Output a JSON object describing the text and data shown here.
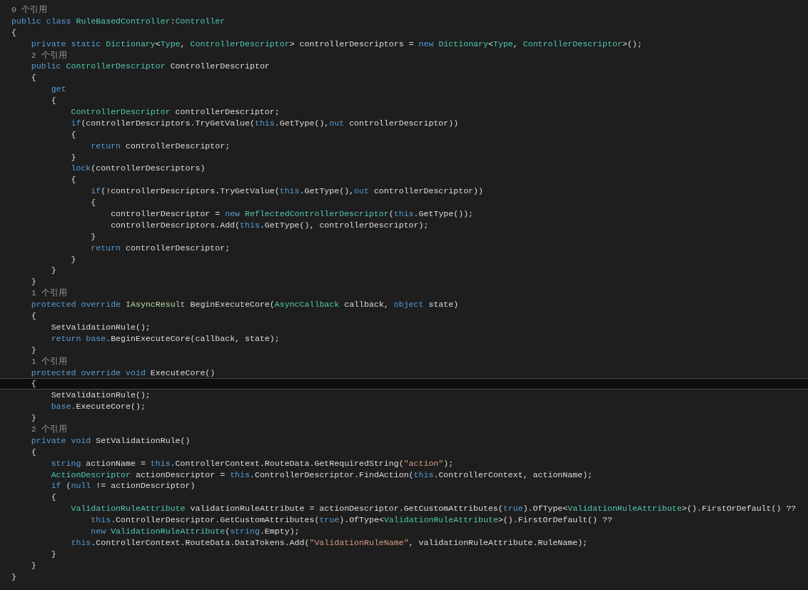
{
  "editor": {
    "lines": [
      {
        "kind": "codelens",
        "current": false,
        "tokens": [
          {
            "kind": "plain",
            "text": "0 个引用"
          }
        ]
      },
      {
        "kind": "code",
        "current": false,
        "tokens": [
          {
            "kind": "keyword",
            "text": "public class "
          },
          {
            "kind": "type",
            "text": "RuleBasedController"
          },
          {
            "kind": "plain",
            "text": ":"
          },
          {
            "kind": "type",
            "text": "Controller"
          }
        ]
      },
      {
        "kind": "code",
        "current": false,
        "tokens": [
          {
            "kind": "plain",
            "text": "{"
          }
        ]
      },
      {
        "kind": "code",
        "current": false,
        "tokens": [
          {
            "kind": "keyword",
            "text": "    private static "
          },
          {
            "kind": "type",
            "text": "Dictionary"
          },
          {
            "kind": "plain",
            "text": "<"
          },
          {
            "kind": "type",
            "text": "Type"
          },
          {
            "kind": "plain",
            "text": ", "
          },
          {
            "kind": "type",
            "text": "ControllerDescriptor"
          },
          {
            "kind": "plain",
            "text": "> controllerDescriptors = "
          },
          {
            "kind": "keyword",
            "text": "new "
          },
          {
            "kind": "type",
            "text": "Dictionary"
          },
          {
            "kind": "plain",
            "text": "<"
          },
          {
            "kind": "type",
            "text": "Type"
          },
          {
            "kind": "plain",
            "text": ", "
          },
          {
            "kind": "type",
            "text": "ControllerDescriptor"
          },
          {
            "kind": "plain",
            "text": ">();"
          }
        ]
      },
      {
        "kind": "codelens",
        "current": false,
        "tokens": [
          {
            "kind": "plain",
            "text": "    2 个引用"
          }
        ]
      },
      {
        "kind": "code",
        "current": false,
        "tokens": [
          {
            "kind": "keyword",
            "text": "    public "
          },
          {
            "kind": "type",
            "text": "ControllerDescriptor"
          },
          {
            "kind": "plain",
            "text": " ControllerDescriptor"
          }
        ]
      },
      {
        "kind": "code",
        "current": false,
        "tokens": [
          {
            "kind": "plain",
            "text": "    {"
          }
        ]
      },
      {
        "kind": "code",
        "current": false,
        "tokens": [
          {
            "kind": "keyword",
            "text": "        get"
          }
        ]
      },
      {
        "kind": "code",
        "current": false,
        "tokens": [
          {
            "kind": "plain",
            "text": "        {"
          }
        ]
      },
      {
        "kind": "code",
        "current": false,
        "tokens": [
          {
            "kind": "type",
            "text": "            ControllerDescriptor"
          },
          {
            "kind": "plain",
            "text": " controllerDescriptor;"
          }
        ]
      },
      {
        "kind": "code",
        "current": false,
        "tokens": [
          {
            "kind": "keyword",
            "text": "            if"
          },
          {
            "kind": "plain",
            "text": "(controllerDescriptors.TryGetValue("
          },
          {
            "kind": "keyword",
            "text": "this"
          },
          {
            "kind": "plain",
            "text": ".GetType(),"
          },
          {
            "kind": "keyword",
            "text": "out"
          },
          {
            "kind": "plain",
            "text": " controllerDescriptor))"
          }
        ]
      },
      {
        "kind": "code",
        "current": false,
        "tokens": [
          {
            "kind": "plain",
            "text": "            {"
          }
        ]
      },
      {
        "kind": "code",
        "current": false,
        "tokens": [
          {
            "kind": "keyword",
            "text": "                return"
          },
          {
            "kind": "plain",
            "text": " controllerDescriptor;"
          }
        ]
      },
      {
        "kind": "code",
        "current": false,
        "tokens": [
          {
            "kind": "plain",
            "text": "            }"
          }
        ]
      },
      {
        "kind": "code",
        "current": false,
        "tokens": [
          {
            "kind": "keyword",
            "text": "            lock"
          },
          {
            "kind": "plain",
            "text": "(controllerDescriptors)"
          }
        ]
      },
      {
        "kind": "code",
        "current": false,
        "tokens": [
          {
            "kind": "plain",
            "text": "            {"
          }
        ]
      },
      {
        "kind": "code",
        "current": false,
        "tokens": [
          {
            "kind": "keyword",
            "text": "                if"
          },
          {
            "kind": "plain",
            "text": "(!controllerDescriptors.TryGetValue("
          },
          {
            "kind": "keyword",
            "text": "this"
          },
          {
            "kind": "plain",
            "text": ".GetType(),"
          },
          {
            "kind": "keyword",
            "text": "out"
          },
          {
            "kind": "plain",
            "text": " controllerDescriptor))"
          }
        ]
      },
      {
        "kind": "code",
        "current": false,
        "tokens": [
          {
            "kind": "plain",
            "text": "                {"
          }
        ]
      },
      {
        "kind": "code",
        "current": false,
        "tokens": [
          {
            "kind": "plain",
            "text": "                    controllerDescriptor = "
          },
          {
            "kind": "keyword",
            "text": "new "
          },
          {
            "kind": "type",
            "text": "ReflectedControllerDescriptor"
          },
          {
            "kind": "plain",
            "text": "("
          },
          {
            "kind": "keyword",
            "text": "this"
          },
          {
            "kind": "plain",
            "text": ".GetType());"
          }
        ]
      },
      {
        "kind": "code",
        "current": false,
        "tokens": [
          {
            "kind": "plain",
            "text": "                    controllerDescriptors.Add("
          },
          {
            "kind": "keyword",
            "text": "this"
          },
          {
            "kind": "plain",
            "text": ".GetType(), controllerDescriptor);"
          }
        ]
      },
      {
        "kind": "code",
        "current": false,
        "tokens": [
          {
            "kind": "plain",
            "text": "                }"
          }
        ]
      },
      {
        "kind": "code",
        "current": false,
        "tokens": [
          {
            "kind": "keyword",
            "text": "                return"
          },
          {
            "kind": "plain",
            "text": " controllerDescriptor;"
          }
        ]
      },
      {
        "kind": "code",
        "current": false,
        "tokens": [
          {
            "kind": "plain",
            "text": "            }"
          }
        ]
      },
      {
        "kind": "code",
        "current": false,
        "tokens": [
          {
            "kind": "plain",
            "text": "        }"
          }
        ]
      },
      {
        "kind": "code",
        "current": false,
        "tokens": [
          {
            "kind": "plain",
            "text": "    }"
          }
        ]
      },
      {
        "kind": "codelens",
        "current": false,
        "tokens": [
          {
            "kind": "plain",
            "text": "    1 个引用"
          }
        ]
      },
      {
        "kind": "code",
        "current": false,
        "tokens": [
          {
            "kind": "keyword",
            "text": "    protected override "
          },
          {
            "kind": "interface",
            "text": "IAsyncResult"
          },
          {
            "kind": "plain",
            "text": " BeginExecuteCore("
          },
          {
            "kind": "type",
            "text": "AsyncCallback"
          },
          {
            "kind": "plain",
            "text": " callback, "
          },
          {
            "kind": "keyword",
            "text": "object"
          },
          {
            "kind": "plain",
            "text": " state)"
          }
        ]
      },
      {
        "kind": "code",
        "current": false,
        "tokens": [
          {
            "kind": "plain",
            "text": "    {"
          }
        ]
      },
      {
        "kind": "code",
        "current": false,
        "tokens": [
          {
            "kind": "plain",
            "text": "        SetValidationRule();"
          }
        ]
      },
      {
        "kind": "code",
        "current": false,
        "tokens": [
          {
            "kind": "keyword",
            "text": "        return base"
          },
          {
            "kind": "plain",
            "text": ".BeginExecuteCore(callback, state);"
          }
        ]
      },
      {
        "kind": "code",
        "current": false,
        "tokens": [
          {
            "kind": "plain",
            "text": "    }"
          }
        ]
      },
      {
        "kind": "codelens",
        "current": false,
        "tokens": [
          {
            "kind": "plain",
            "text": "    1 个引用"
          }
        ]
      },
      {
        "kind": "code",
        "current": false,
        "tokens": [
          {
            "kind": "keyword",
            "text": "    protected override void"
          },
          {
            "kind": "plain",
            "text": " ExecuteCore()"
          }
        ]
      },
      {
        "kind": "code",
        "current": true,
        "tokens": [
          {
            "kind": "plain",
            "text": "    {"
          }
        ]
      },
      {
        "kind": "code",
        "current": false,
        "tokens": [
          {
            "kind": "plain",
            "text": "        SetValidationRule();"
          }
        ]
      },
      {
        "kind": "code",
        "current": false,
        "tokens": [
          {
            "kind": "keyword",
            "text": "        base"
          },
          {
            "kind": "plain",
            "text": ".ExecuteCore();"
          }
        ]
      },
      {
        "kind": "code",
        "current": false,
        "tokens": [
          {
            "kind": "plain",
            "text": "    }"
          }
        ]
      },
      {
        "kind": "codelens",
        "current": false,
        "tokens": [
          {
            "kind": "plain",
            "text": "    2 个引用"
          }
        ]
      },
      {
        "kind": "code",
        "current": false,
        "tokens": [
          {
            "kind": "keyword",
            "text": "    private void"
          },
          {
            "kind": "plain",
            "text": " SetValidationRule()"
          }
        ]
      },
      {
        "kind": "code",
        "current": false,
        "tokens": [
          {
            "kind": "plain",
            "text": "    {"
          }
        ]
      },
      {
        "kind": "code",
        "current": false,
        "tokens": [
          {
            "kind": "keyword",
            "text": "        string"
          },
          {
            "kind": "plain",
            "text": " actionName = "
          },
          {
            "kind": "keyword",
            "text": "this"
          },
          {
            "kind": "plain",
            "text": ".ControllerContext.RouteData.GetRequiredString("
          },
          {
            "kind": "string",
            "text": "\"action\""
          },
          {
            "kind": "plain",
            "text": ");"
          }
        ]
      },
      {
        "kind": "code",
        "current": false,
        "tokens": [
          {
            "kind": "type",
            "text": "        ActionDescriptor"
          },
          {
            "kind": "plain",
            "text": " actionDescriptor = "
          },
          {
            "kind": "keyword",
            "text": "this"
          },
          {
            "kind": "plain",
            "text": ".ControllerDescriptor.FindAction("
          },
          {
            "kind": "keyword",
            "text": "this"
          },
          {
            "kind": "plain",
            "text": ".ControllerContext, actionName);"
          }
        ]
      },
      {
        "kind": "code",
        "current": false,
        "tokens": [
          {
            "kind": "keyword",
            "text": "        if"
          },
          {
            "kind": "plain",
            "text": " ("
          },
          {
            "kind": "keyword",
            "text": "null"
          },
          {
            "kind": "plain",
            "text": " != actionDescriptor)"
          }
        ]
      },
      {
        "kind": "code",
        "current": false,
        "tokens": [
          {
            "kind": "plain",
            "text": "        {"
          }
        ]
      },
      {
        "kind": "code",
        "current": false,
        "tokens": [
          {
            "kind": "type",
            "text": "            ValidationRuleAttribute"
          },
          {
            "kind": "plain",
            "text": " validationRuleAttribute = actionDescriptor.GetCustomAttributes("
          },
          {
            "kind": "keyword",
            "text": "true"
          },
          {
            "kind": "plain",
            "text": ").OfType<"
          },
          {
            "kind": "type",
            "text": "ValidationRuleAttribute"
          },
          {
            "kind": "plain",
            "text": ">().FirstOrDefault() ??"
          }
        ]
      },
      {
        "kind": "code",
        "current": false,
        "tokens": [
          {
            "kind": "keyword",
            "text": "                this"
          },
          {
            "kind": "plain",
            "text": ".ControllerDescriptor.GetCustomAttributes("
          },
          {
            "kind": "keyword",
            "text": "true"
          },
          {
            "kind": "plain",
            "text": ").OfType<"
          },
          {
            "kind": "type",
            "text": "ValidationRuleAttribute"
          },
          {
            "kind": "plain",
            "text": ">().FirstOrDefault() ??"
          }
        ]
      },
      {
        "kind": "code",
        "current": false,
        "tokens": [
          {
            "kind": "keyword",
            "text": "                new "
          },
          {
            "kind": "type",
            "text": "ValidationRuleAttribute"
          },
          {
            "kind": "plain",
            "text": "("
          },
          {
            "kind": "keyword",
            "text": "string"
          },
          {
            "kind": "plain",
            "text": ".Empty);"
          }
        ]
      },
      {
        "kind": "code",
        "current": false,
        "tokens": [
          {
            "kind": "keyword",
            "text": "            this"
          },
          {
            "kind": "plain",
            "text": ".ControllerContext.RouteData.DataTokens.Add("
          },
          {
            "kind": "string",
            "text": "\"ValidationRuleName\""
          },
          {
            "kind": "plain",
            "text": ", validationRuleAttribute.RuleName);"
          }
        ]
      },
      {
        "kind": "code",
        "current": false,
        "tokens": [
          {
            "kind": "plain",
            "text": "        }"
          }
        ]
      },
      {
        "kind": "code",
        "current": false,
        "tokens": [
          {
            "kind": "plain",
            "text": "    }"
          }
        ]
      },
      {
        "kind": "code",
        "current": false,
        "tokens": [
          {
            "kind": "plain",
            "text": "}"
          }
        ]
      }
    ]
  }
}
